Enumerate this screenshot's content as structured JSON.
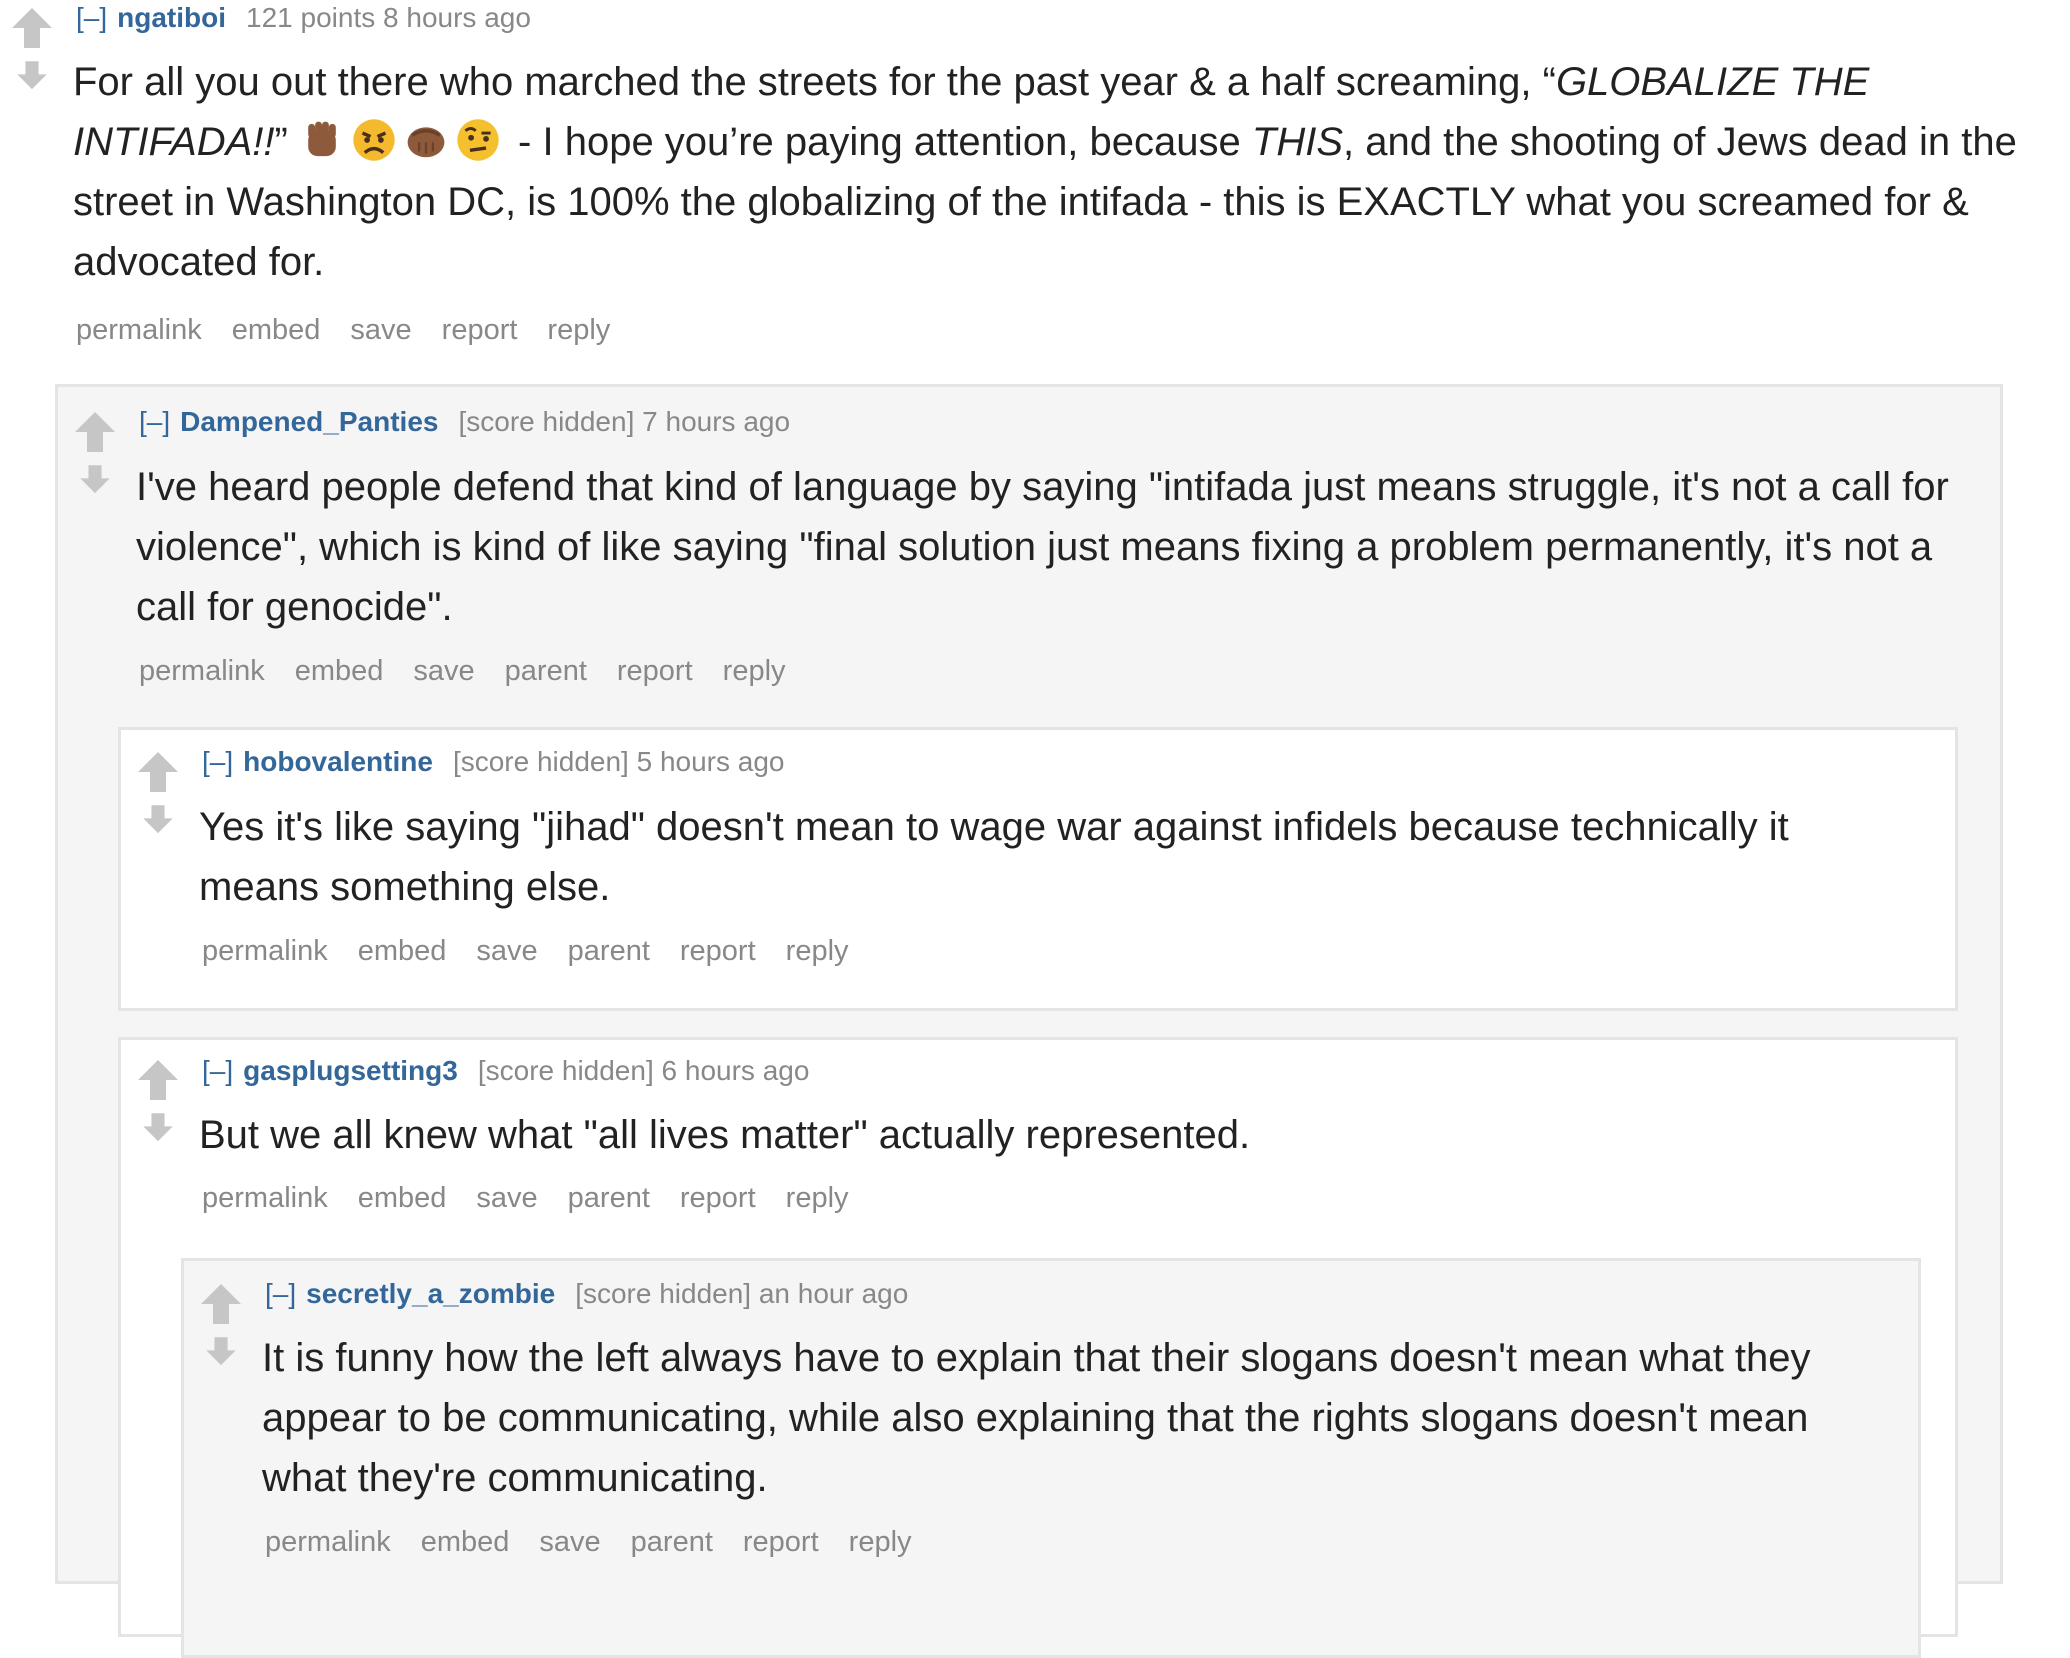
{
  "actions_labels": {
    "permalink": "permalink",
    "embed": "embed",
    "save": "save",
    "parent": "parent",
    "report": "report",
    "reply": "reply"
  },
  "comments": [
    {
      "toggle": "[–]",
      "author": "ngatiboi",
      "score": "121 points",
      "time": "8 hours ago",
      "text_1": "For all you out there who marched the streets for the past year & a half screaming, “",
      "text_2": "GLOBALIZE THE INTIFADA!!",
      "text_3": "”",
      "text_4": " - I hope you’re paying attention, because ",
      "text_5": "THIS",
      "text_6": ", and the shooting of Jews dead in the street in Washington DC, is 100% the globalizing of the intifada - this is EXACTLY what you screamed for & advocated for.",
      "emojis": [
        "raised-fist-icon",
        "angry-face-icon",
        "fist-bump-icon",
        "raised-eyebrow-face-icon"
      ]
    },
    {
      "toggle": "[–]",
      "author": "Dampened_Panties",
      "score": "[score hidden]",
      "time": "7 hours ago",
      "text": "I've heard people defend that kind of language by saying \"intifada just means struggle, it's not a call for violence\", which is kind of like saying \"final solution just means fixing a problem permanently, it's not a call for genocide\"."
    },
    {
      "toggle": "[–]",
      "author": "hobovalentine",
      "score": "[score hidden]",
      "time": "5 hours ago",
      "text": "Yes it's like saying \"jihad\" doesn't mean to wage war against infidels because technically it means something else."
    },
    {
      "toggle": "[–]",
      "author": "gasplugsetting3",
      "score": "[score hidden]",
      "time": "6 hours ago",
      "text": "But we all knew what \"all lives matter\" actually represented."
    },
    {
      "toggle": "[–]",
      "author": "secretly_a_zombie",
      "score": "[score hidden]",
      "time": "an hour ago",
      "text": "It is funny how the left always have to explain that their slogans doesn't mean what they appear to be communicating, while also explaining that the rights slogans doesn't mean what they're communicating."
    }
  ],
  "colors": {
    "author": "#336699",
    "meta": "#888888",
    "body": "#222222",
    "nested_gray": "#f5f5f5",
    "border": "#e4e4e4",
    "arrow": "#c6c6c6"
  }
}
